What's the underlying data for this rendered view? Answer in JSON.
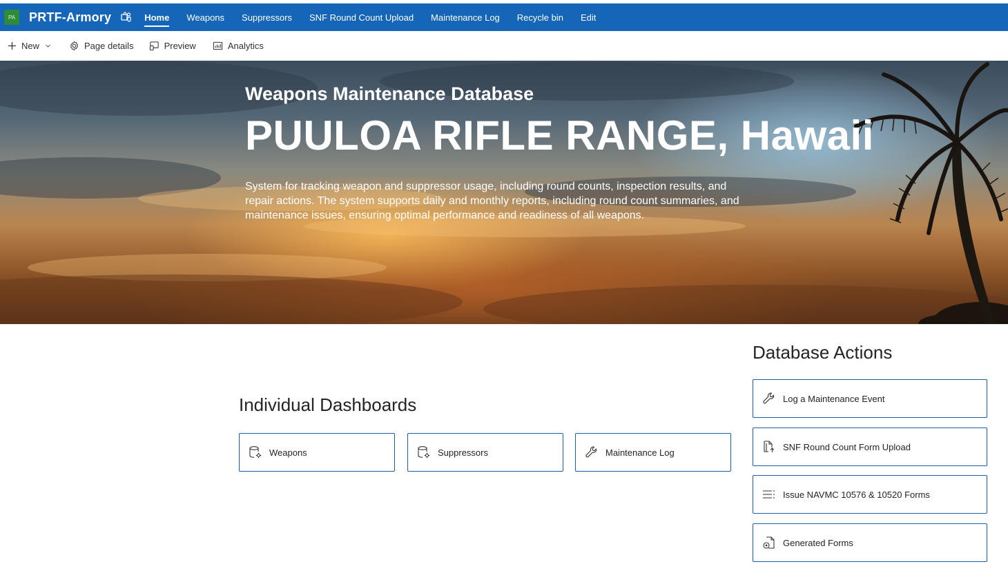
{
  "site": {
    "logo_text": "PA",
    "title": "PRTF-Armory",
    "brand_color": "#1565b8"
  },
  "nav": {
    "items": [
      {
        "label": "Home",
        "active": true
      },
      {
        "label": "Weapons"
      },
      {
        "label": "Suppressors"
      },
      {
        "label": "SNF Round Count Upload"
      },
      {
        "label": "Maintenance Log"
      },
      {
        "label": "Recycle bin"
      },
      {
        "label": "Edit"
      }
    ]
  },
  "commandbar": {
    "new_label": "New",
    "page_details_label": "Page details",
    "preview_label": "Preview",
    "analytics_label": "Analytics"
  },
  "hero": {
    "eyebrow": "Weapons Maintenance Database",
    "title": "PUULOA RIFLE RANGE, Hawaii",
    "description": "System for tracking weapon and suppressor usage, including round counts, inspection results, and repair actions. The system supports daily and monthly reports, including round count summaries, and maintenance issues, ensuring optimal performance and readiness of all weapons."
  },
  "dashboards": {
    "title": "Individual Dashboards",
    "tiles": [
      {
        "label": "Weapons",
        "icon": "database-gear-icon"
      },
      {
        "label": "Suppressors",
        "icon": "database-gear-icon"
      },
      {
        "label": "Maintenance Log",
        "icon": "wrench-icon"
      }
    ]
  },
  "actions": {
    "title": "Database Actions",
    "tiles": [
      {
        "label": "Log a Maintenance Event",
        "icon": "wrench-icon"
      },
      {
        "label": "SNF Round Count Form Upload",
        "icon": "document-upload-icon"
      },
      {
        "label": "Issue NAVMC 10576 & 10520 Forms",
        "icon": "list-icon"
      },
      {
        "label": "Generated Forms",
        "icon": "document-gear-icon"
      }
    ]
  }
}
